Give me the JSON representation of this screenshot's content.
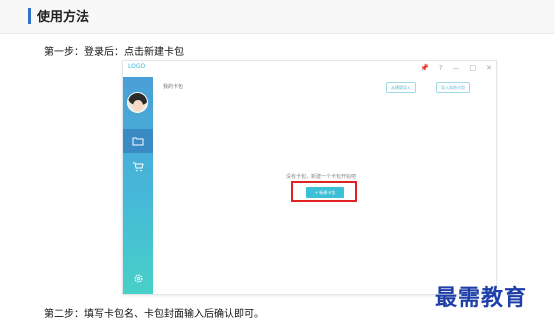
{
  "section": {
    "title": "使用方法"
  },
  "steps": {
    "step1": "第一步：登录后：点击新建卡包",
    "step2": "第二步：填写卡包名、卡包封面输入后确认即可。"
  },
  "app": {
    "logo": "LOGO",
    "window_controls": [
      "📌",
      "?",
      "—",
      "□",
      "✕"
    ],
    "page_label": "我的卡包",
    "import_button": "从模版导入",
    "add_button": "导入本地卡包",
    "empty_text": "没有卡包，新建一个卡包开始吧",
    "new_button": "+ 新建卡包",
    "highlight_color": "#e02424",
    "sidebar_icons": [
      "avatar",
      "folder-icon",
      "cart-icon",
      "gear-icon"
    ]
  },
  "watermark": "最需教育"
}
